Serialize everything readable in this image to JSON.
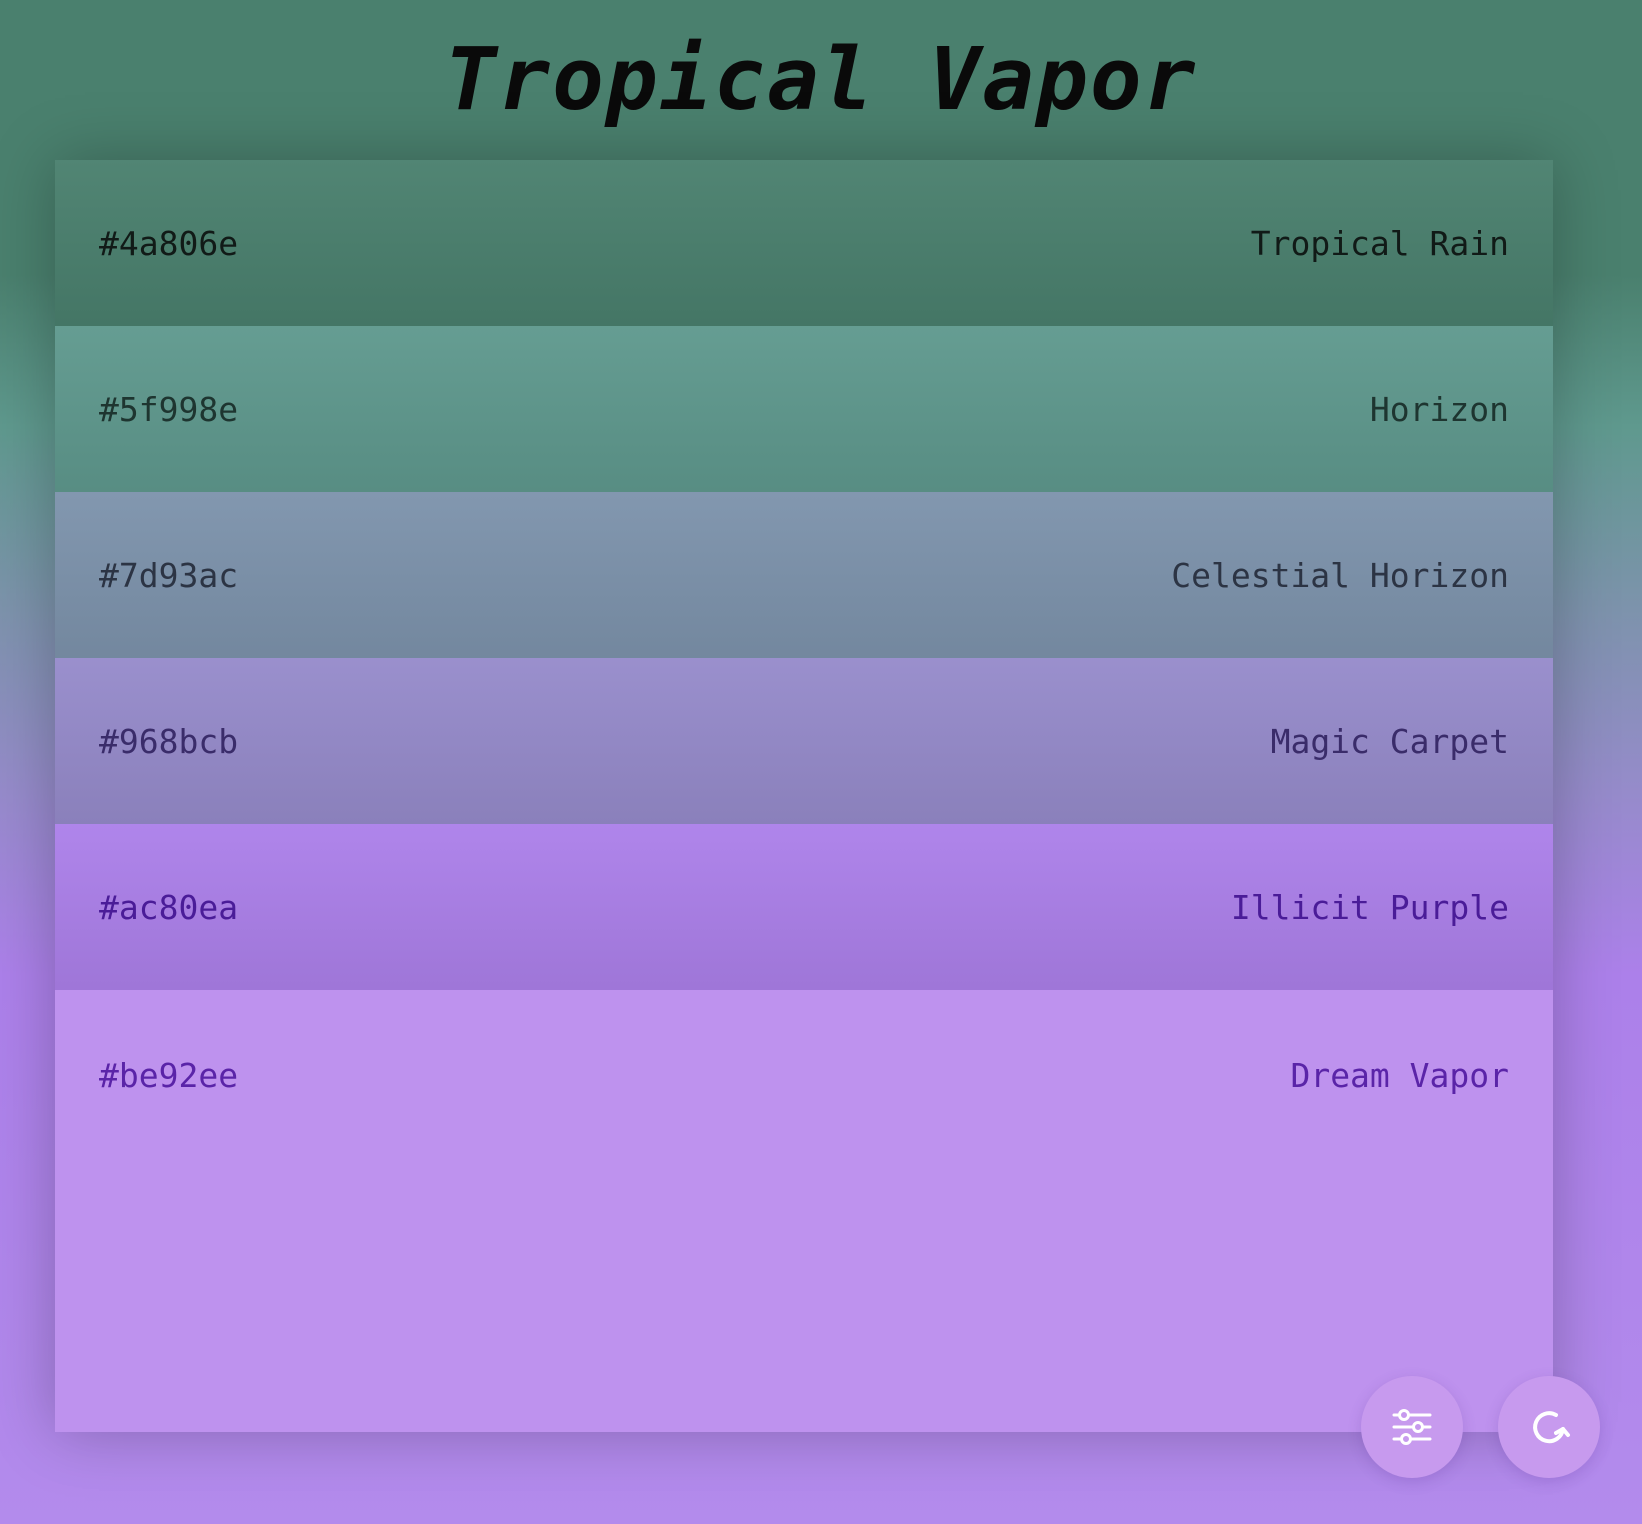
{
  "title": "Tropical Vapor",
  "swatches": [
    {
      "hex": "#4a806e",
      "name": "Tropical Rain",
      "bg": "#4a806e",
      "text": "#111a17"
    },
    {
      "hex": "#5f998e",
      "name": "Horizon",
      "bg": "#5f998e",
      "text": "#1e3530"
    },
    {
      "hex": "#7d93ac",
      "name": "Celestial Horizon",
      "bg": "#7d93ac",
      "text": "#2c3444"
    },
    {
      "hex": "#968bcb",
      "name": "Magic Carpet",
      "bg": "#968bcb",
      "text": "#3a2c6a"
    },
    {
      "hex": "#ac80ea",
      "name": "Illicit Purple",
      "bg": "#ac80ea",
      "text": "#4a1c98"
    },
    {
      "hex": "#be92ee",
      "name": "Dream Vapor",
      "bg": "#be92ee",
      "text": "#5a24a8"
    }
  ],
  "actions": {
    "settings_icon": "sliders-icon",
    "refresh_icon": "refresh-icon"
  }
}
